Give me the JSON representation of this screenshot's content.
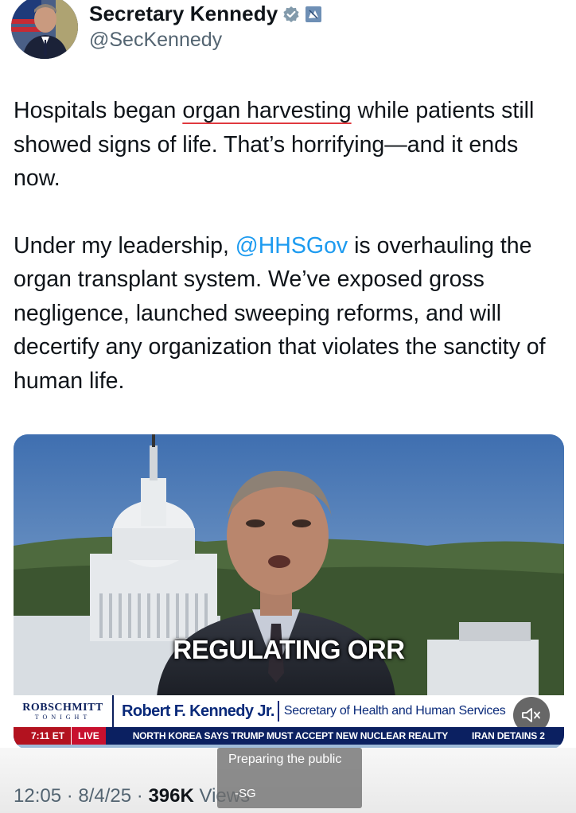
{
  "author": {
    "display_name": "Secretary Kennedy",
    "handle": "@SecKennedy",
    "verified_icon": "verified-badge-icon",
    "affiliation_icon": "government-flag-icon"
  },
  "tweet": {
    "p1_before": "Hospitals began",
    "p1_highlight": "organ harvesting",
    "p1_after": " while patients still showed signs of life. That’s horrifying—and it ends now.",
    "p2_before": "Under my leadership, ",
    "p2_mention": "@HHSGov",
    "p2_after": " is overhauling the organ transplant system. We’ve exposed gross negligence, launched sweeping reforms, and will decertify any organization that violates the sanctity of human life."
  },
  "video": {
    "caption": "REGULATING ORR",
    "show_logo_line1": "ROBSCHMITT",
    "show_logo_line2": "TONIGHT",
    "lower_third_name": "Robert F. Kennedy Jr.",
    "lower_third_title": "Secretary of Health and Human Services",
    "ticker_time": "7:11 ET",
    "ticker_live": "LIVE",
    "ticker_headline": "NORTH KOREA SAYS TRUMP MUST ACCEPT NEW NUCLEAR REALITY",
    "ticker_headline2": "IRAN DETAINS 2",
    "mute_icon": "speaker-muted-icon"
  },
  "meta": {
    "time": "12:05",
    "sep1": " · ",
    "date": "8/4/25",
    "sep2": " · ",
    "views_count": "396K",
    "views_label": " Views"
  },
  "overlay_caption": {
    "line1": "Preparing the public",
    "line2": "-SG"
  },
  "colors": {
    "link": "#1d9bf0",
    "underline": "#e0393e",
    "ticker_bg": "#0b2061",
    "live_red": "#c8102e"
  }
}
